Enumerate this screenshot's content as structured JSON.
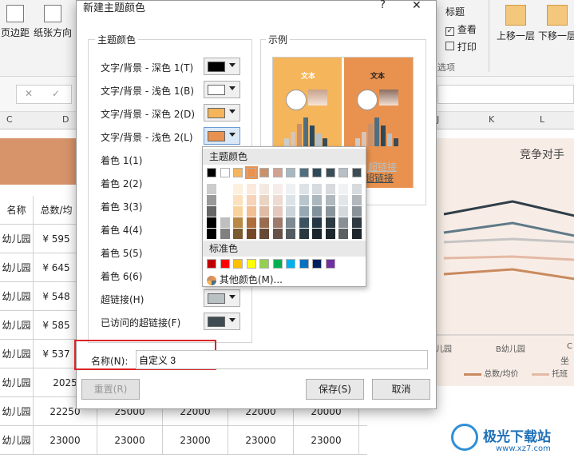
{
  "ribbon": {
    "left_buttons": [
      {
        "label": "页边距"
      },
      {
        "label": "纸张方向"
      }
    ],
    "title_label": "标题",
    "checks": [
      {
        "label": "查看",
        "checked": true
      },
      {
        "label": "打印",
        "checked": false
      }
    ],
    "group_label": "选项",
    "arrange_buttons": [
      {
        "label": "上移一层"
      },
      {
        "label": "下移一层"
      }
    ]
  },
  "formula_bar": {
    "cancel_glyph": "✕",
    "confirm_glyph": "✓"
  },
  "column_headers": {
    "left": [
      "C",
      "D"
    ],
    "right": [
      "J",
      "K",
      "L"
    ]
  },
  "sheet": {
    "header": [
      "名称",
      "总数/均"
    ],
    "rows": [
      [
        "幼儿园",
        "¥ 595"
      ],
      [
        "幼儿园",
        "¥ 645"
      ],
      [
        "幼儿园",
        "¥ 548"
      ],
      [
        "幼儿园",
        "¥ 585"
      ],
      [
        "幼儿园",
        "¥ 537"
      ],
      [
        "幼儿园",
        "2025"
      ],
      [
        "幼儿园",
        "22250",
        "25000",
        "22000",
        "22000",
        "20000"
      ],
      [
        "幼儿园",
        "23000",
        "23000",
        "23000",
        "23000",
        "23000"
      ]
    ]
  },
  "chart": {
    "title": "竞争对手",
    "x_labels": [
      "幼儿园",
      "B幼儿园",
      "C"
    ],
    "axis_title": "坐",
    "legend": [
      "总数/均价",
      "托班"
    ]
  },
  "dialog": {
    "title": "新建主题颜色",
    "help": "?",
    "close": "✕",
    "theme_group": "主题颜色",
    "preview_group": "示例",
    "rows": [
      {
        "label": "文字/背景 - 深色 1(T)",
        "color": "#000000"
      },
      {
        "label": "文字/背景 - 浅色 1(B)",
        "color": "#ffffff"
      },
      {
        "label": "文字/背景 - 深色 2(D)",
        "color": "#f5b55a"
      },
      {
        "label": "文字/背景 - 浅色 2(L)",
        "color": "#e9924f"
      },
      {
        "label": "着色 1(1)"
      },
      {
        "label": "着色 2(2)"
      },
      {
        "label": "着色 3(3)"
      },
      {
        "label": "着色 4(4)"
      },
      {
        "label": "着色 5(5)"
      },
      {
        "label": "着色 6(6)"
      },
      {
        "label": "超链接(H)",
        "color": "#b9c1c3"
      },
      {
        "label": "已访问的超链接(F)",
        "color": "#3e4c52"
      }
    ],
    "name_label": "名称(N):",
    "name_value": "自定义 3",
    "reset": "重置(R)",
    "save": "保存(S)",
    "cancel": "取消",
    "preview": {
      "text1": "文本",
      "text2": "文本",
      "link": "超链接",
      "visited": "超链接"
    }
  },
  "color_popup": {
    "theme_title": "主题颜色",
    "standard_title": "标准色",
    "more": "其他颜色(M)...",
    "theme_top": [
      "#000000",
      "#ffffff",
      "#f5b55a",
      "#e9924f",
      "#c9906a",
      "#d2a291",
      "#a7b8c1",
      "#4f6e80",
      "#2e4a5a",
      "#3a4d58",
      "#b6c0c6",
      "#3c4b55"
    ],
    "standard": [
      "#c00000",
      "#ff0000",
      "#ffc000",
      "#ffff00",
      "#92d050",
      "#00b050",
      "#00b0f0",
      "#0070c0",
      "#002060",
      "#7030a0"
    ]
  },
  "watermark": {
    "text": "极光下载站",
    "url": "www.xz7.com"
  }
}
